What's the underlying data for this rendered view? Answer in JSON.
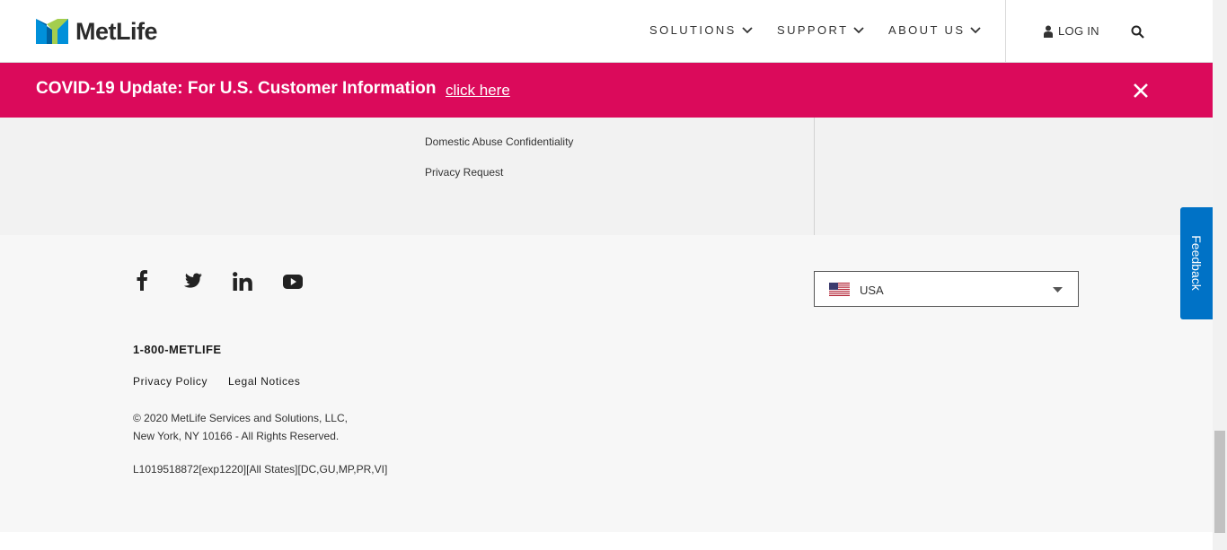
{
  "header": {
    "logo_text": "MetLife",
    "nav": [
      {
        "label": "SOLUTIONS"
      },
      {
        "label": "SUPPORT"
      },
      {
        "label": "ABOUT US"
      }
    ],
    "login_label": "LOG IN"
  },
  "banner": {
    "text": "COVID-19 Update: For U.S. Customer Information",
    "link_label": "click here",
    "color": "#db0a5b"
  },
  "links": [
    {
      "label": "Domestic Abuse Confidentiality"
    },
    {
      "label": "Privacy Request"
    }
  ],
  "footer": {
    "social": [
      "facebook-icon",
      "twitter-icon",
      "linkedin-icon",
      "youtube-icon"
    ],
    "phone": "1-800-METLIFE",
    "legal": [
      {
        "label": "Privacy Policy"
      },
      {
        "label": "Legal Notices"
      }
    ],
    "copyright_line1": "© 2020 MetLife Services and Solutions, LLC,",
    "copyright_line2": "New York, NY 10166 - All Rights Reserved.",
    "code": "L1019518872[exp1220][All States][DC,GU,MP,PR,VI]",
    "country_selected": "USA"
  },
  "feedback_label": "Feedback",
  "colors": {
    "brand_green": "#a4ce4e",
    "brand_blue": "#0090da",
    "feedback_blue": "#0072c6"
  }
}
